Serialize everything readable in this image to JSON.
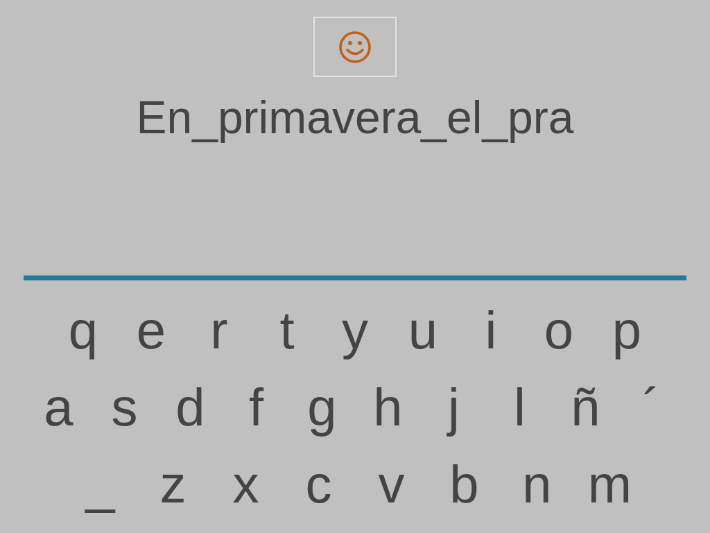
{
  "typed_text": "En_primavera_el_pra",
  "keyboard": {
    "rows": [
      [
        "q",
        "e",
        "r",
        "t",
        "y",
        "u",
        "i",
        "o",
        "p"
      ],
      [
        "a",
        "s",
        "d",
        "f",
        "g",
        "h",
        "j",
        "l",
        "ñ",
        "´"
      ],
      [
        "_",
        "z",
        "x",
        "c",
        "v",
        "b",
        "n",
        "m"
      ]
    ]
  }
}
